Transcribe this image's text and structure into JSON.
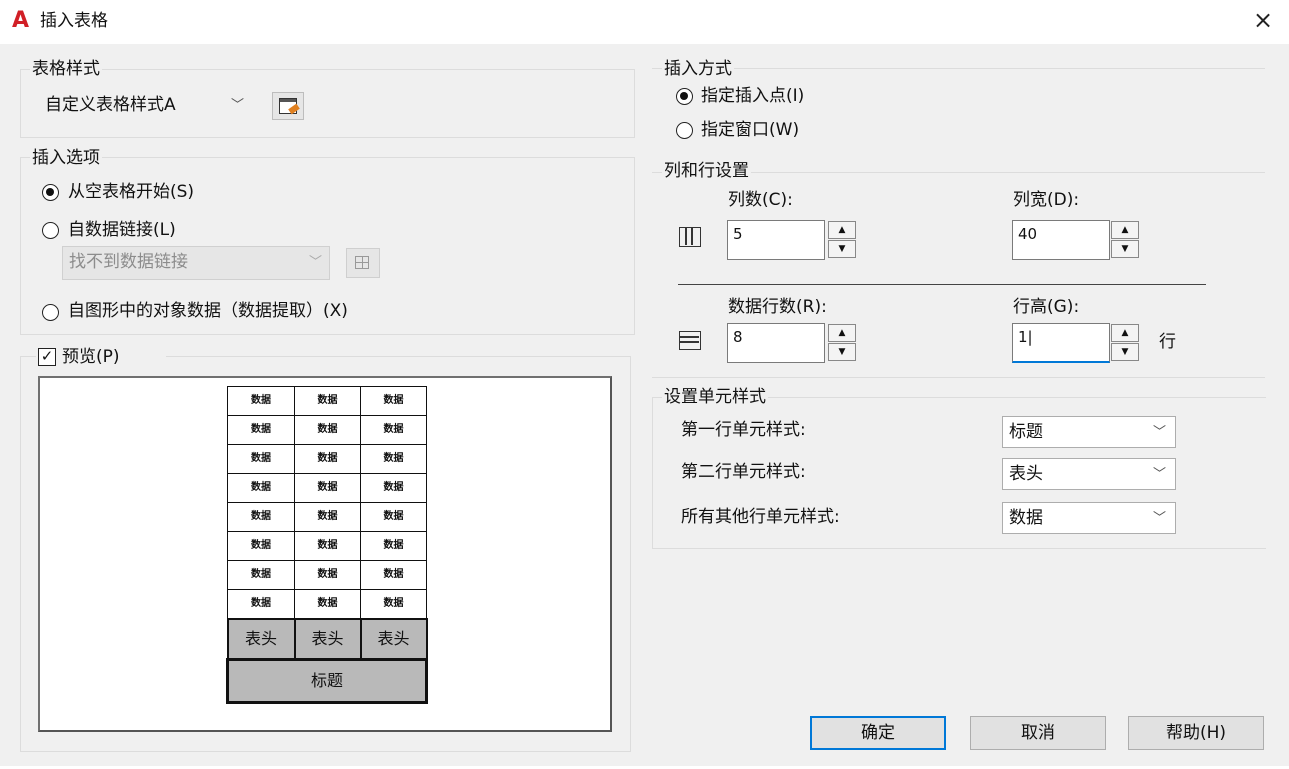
{
  "window": {
    "title": "插入表格",
    "logo_letter": "A",
    "close_glyph": "×"
  },
  "table_style": {
    "legend": "表格样式",
    "selected": "自定义表格样式A"
  },
  "insert_options": {
    "legend": "插入选项",
    "from_empty": "从空表格开始(S)",
    "from_link": "自数据链接(L)",
    "link_placeholder": "找不到数据链接",
    "from_drawing": "自图形中的对象数据（数据提取）(X)"
  },
  "preview": {
    "checkbox_label": "预览(P)",
    "checked": true,
    "data_cell": "数据",
    "data_rows": 8,
    "columns": 3,
    "header_cell": "表头",
    "title_cell": "标题"
  },
  "insert_method": {
    "legend": "插入方式",
    "point": "指定插入点(I)",
    "window": "指定窗口(W)"
  },
  "col_row": {
    "legend": "列和行设置",
    "col_count_label": "列数(C):",
    "col_count": "5",
    "col_width_label": "列宽(D):",
    "col_width": "40",
    "row_count_label": "数据行数(R):",
    "row_count": "8",
    "row_height_label": "行高(G):",
    "row_height": "1|",
    "row_unit": "行"
  },
  "cell_styles": {
    "legend": "设置单元样式",
    "first_label": "第一行单元样式:",
    "first_value": "标题",
    "second_label": "第二行单元样式:",
    "second_value": "表头",
    "other_label": "所有其他行单元样式:",
    "other_value": "数据"
  },
  "buttons": {
    "ok": "确定",
    "cancel": "取消",
    "help": "帮助(H)"
  },
  "colors": {
    "logo": "#d11f26",
    "focus": "#0078d7",
    "dialog_bg": "#f0f0f0"
  }
}
